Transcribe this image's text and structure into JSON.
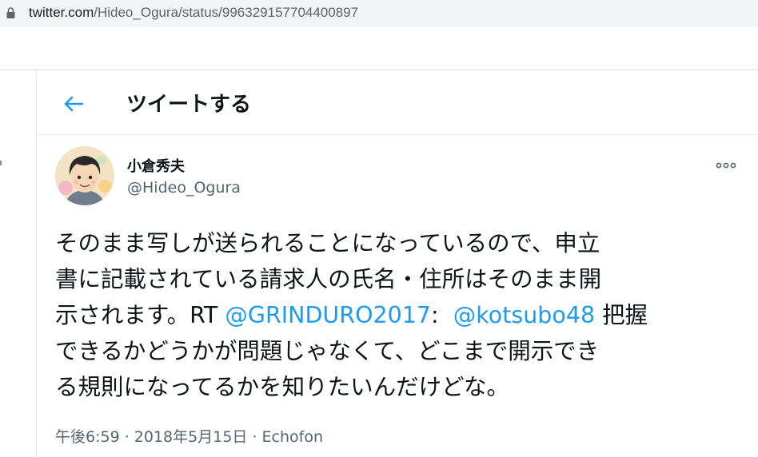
{
  "browser": {
    "url_domain": "twitter.com",
    "url_path": "/Hideo_Ogura/status/996329157704400897"
  },
  "header": {
    "title": "ツイートする"
  },
  "tweet": {
    "author_name": "小倉秀夫",
    "author_handle": "@Hideo_Ogura",
    "text": {
      "line1": "そのまま写しが送られることになっているので、申立",
      "line2": "書に記載されている請求人の氏名・住所はそのまま開",
      "line3_pre": "示されます。RT ",
      "line3_mention1": "@GRINDURO2017",
      "line3_mid": ":  ",
      "line3_mention2": "@kotsubo48",
      "line3_post": " 把握",
      "line4": "できるかどうかが問題じゃなくて、どこまで開示でき",
      "line5": "る規則になってるかを知りたいんだけどな。"
    },
    "time": "午後6:59",
    "separator": " · ",
    "date": "2018年5月15日",
    "source": "Echofon"
  },
  "icons": {
    "lock": "lock-icon",
    "back": "arrow-left-icon",
    "more": "more-icon",
    "accent_color": "#1d9bf0"
  }
}
